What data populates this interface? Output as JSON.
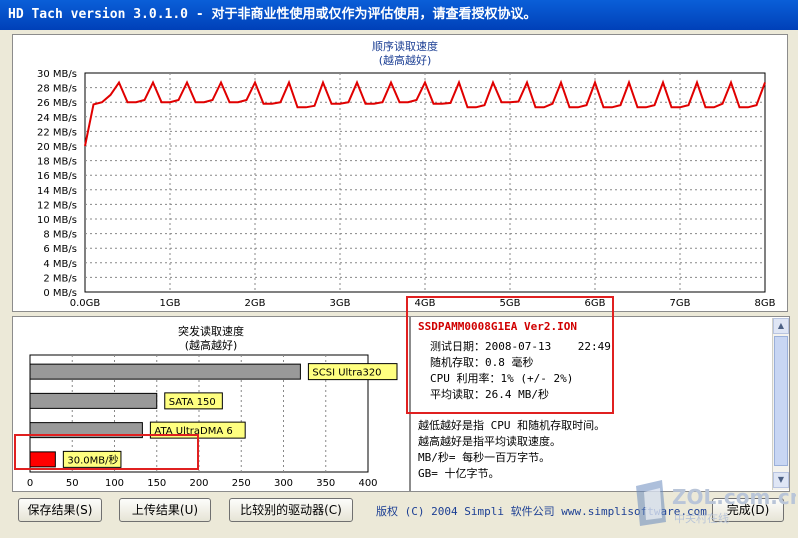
{
  "window": {
    "title": "HD Tach version 3.0.1.0  - 对于非商业性使用或仅作为评估使用，请查看授权协议。"
  },
  "seq_chart": {
    "title": "顺序读取速度",
    "subtitle": "(越高越好)",
    "y_ticks": [
      "30 MB/s",
      "28 MB/s",
      "26 MB/s",
      "24 MB/s",
      "22 MB/s",
      "20 MB/s",
      "18 MB/s",
      "16 MB/s",
      "14 MB/s",
      "12 MB/s",
      "10 MB/s",
      "8 MB/s",
      "6 MB/s",
      "4 MB/s",
      "2 MB/s",
      "0 MB/s"
    ],
    "x_ticks": [
      "0.0GB",
      "1GB",
      "2GB",
      "3GB",
      "4GB",
      "5GB",
      "6GB",
      "7GB",
      "8GB"
    ]
  },
  "burst_chart": {
    "title": "突发读取速度",
    "subtitle": "(越高越好)",
    "x_ticks": [
      "0",
      "50",
      "100",
      "150",
      "200",
      "250",
      "300",
      "350",
      "400"
    ],
    "bars": [
      {
        "label": "SCSI Ultra320",
        "value": 320,
        "color": "#999999"
      },
      {
        "label": "SATA 150",
        "value": 150,
        "color": "#999999"
      },
      {
        "label": "ATA UltraDMA 6",
        "value": 133,
        "color": "#999999"
      },
      {
        "label": "30.0MB/秒",
        "value": 30,
        "color": "#ff0000"
      }
    ]
  },
  "chart_data": [
    {
      "type": "line",
      "title": "顺序读取速度",
      "subtitle": "(越高越好)",
      "xlabel": "",
      "ylabel": "",
      "xlim": [
        0,
        8
      ],
      "ylim": [
        0,
        30
      ],
      "x": [
        0,
        0.1,
        0.2,
        0.3,
        0.4,
        0.5,
        0.6,
        0.7,
        0.8,
        0.9,
        1,
        1.1,
        1.2,
        1.3,
        1.4,
        1.5,
        1.6,
        1.7,
        1.8,
        1.9,
        2,
        2.1,
        2.2,
        2.3,
        2.4,
        2.5,
        2.6,
        2.7,
        2.8,
        2.9,
        3,
        3.1,
        3.2,
        3.3,
        3.4,
        3.5,
        3.6,
        3.7,
        3.8,
        3.9,
        4,
        4.1,
        4.2,
        4.3,
        4.4,
        4.5,
        4.6,
        4.7,
        4.8,
        4.9,
        5,
        5.1,
        5.2,
        5.3,
        5.4,
        5.5,
        5.6,
        5.7,
        5.8,
        5.9,
        6,
        6.1,
        6.2,
        6.3,
        6.4,
        6.5,
        6.6,
        6.7,
        6.8,
        6.9,
        7,
        7.1,
        7.2,
        7.3,
        7.4,
        7.5,
        7.6,
        7.7,
        7.8,
        7.9,
        8
      ],
      "series": [
        {
          "values": [
            20,
            25.7,
            26,
            27,
            28.7,
            26,
            26,
            26.3,
            28.7,
            26,
            26,
            26.3,
            28.7,
            26,
            26,
            26.3,
            28.7,
            26,
            26,
            26.3,
            28.7,
            25.8,
            25.8,
            26,
            28.7,
            25.3,
            25.3,
            25.5,
            28.7,
            25.8,
            25.8,
            26,
            28.7,
            25.8,
            25.8,
            26,
            28.7,
            26,
            26,
            26.3,
            28.7,
            25.8,
            25.8,
            25.9,
            28.7,
            25.3,
            25.3,
            25.6,
            28.7,
            26,
            26,
            26.1,
            28.7,
            25.3,
            25.3,
            25.8,
            28.7,
            25.3,
            25.3,
            25.6,
            28.7,
            25.3,
            25.3,
            25.6,
            28.7,
            25.3,
            25.3,
            25.6,
            28.7,
            25.3,
            25.3,
            25.6,
            28.7,
            25.3,
            25.3,
            25.8,
            28.7,
            25.3,
            25.3,
            25.6,
            28.7,
            25.8,
            25.8
          ]
        }
      ],
      "grid": true
    },
    {
      "type": "bar",
      "orientation": "horizontal",
      "title": "突发读取速度",
      "subtitle": "(越高越好)",
      "categories": [
        "SCSI Ultra320",
        "SATA 150",
        "ATA UltraDMA 6",
        "30.0MB/秒"
      ],
      "values": [
        320,
        150,
        133,
        30
      ],
      "xlim": [
        0,
        400
      ]
    }
  ],
  "info": {
    "drive": "SSDPAMM0008G1EA Ver2.ION",
    "date_label": "测试日期：",
    "date_value": "2008-07-13",
    "time_value": "22:49",
    "random_label": "随机存取：",
    "random_value": "0.8 毫秒",
    "cpu_label": "CPU 利用率：",
    "cpu_value": "1% (+/- 2%)",
    "avg_label": "平均读取：",
    "avg_value": "26.4 MB/秒",
    "notes": [
      "越低越好是指 CPU 和随机存取时间。",
      "越高越好是指平均读取速度。",
      "MB/秒= 每秒一百万字节。",
      "GB= 十亿字节。"
    ]
  },
  "buttons": {
    "save": "保存结果(S)",
    "upload": "上传结果(U)",
    "compare": "比较别的驱动器(C)",
    "done": "完成(D)"
  },
  "footer": {
    "copyright": "版权 (C) 2004 Simpli 软件公司 www.simplisoftware.com"
  },
  "watermark": {
    "brand": "ZOL.com.cn",
    "sub": "中关村在线"
  },
  "colors": {
    "line": "#e00000",
    "annotation": "#e02020",
    "title_bar": "#0a5fd8",
    "bar_label_bg": "#ffff80"
  }
}
